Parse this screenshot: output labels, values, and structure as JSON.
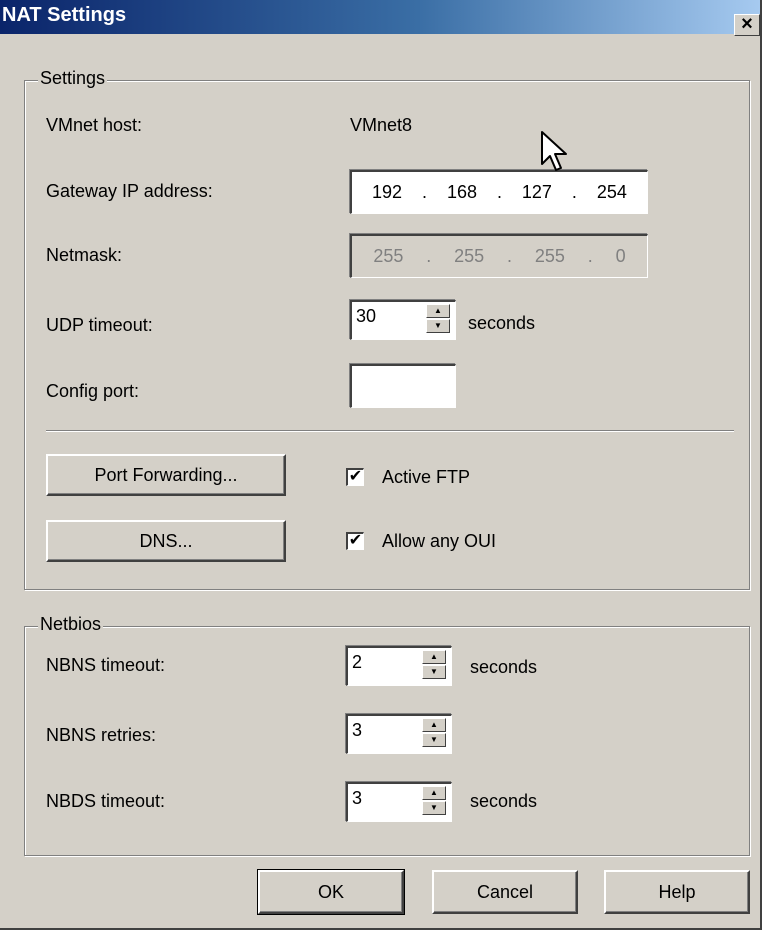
{
  "window": {
    "title": "NAT Settings",
    "close_glyph": "×"
  },
  "settings": {
    "legend": "Settings",
    "vmnet_host_label": "VMnet host:",
    "vmnet_host_value": "VMnet8",
    "gateway_label": "Gateway IP address:",
    "gateway_octets": [
      "192",
      "168",
      "127",
      "254"
    ],
    "netmask_label": "Netmask:",
    "netmask_octets": [
      "255",
      "255",
      "255",
      "0"
    ],
    "udp_timeout_label": "UDP timeout:",
    "udp_timeout_value": "30",
    "udp_timeout_unit": "seconds",
    "config_port_label": "Config port:",
    "config_port_value": "",
    "port_forwarding_button": "Port Forwarding...",
    "dns_button": "DNS...",
    "active_ftp_label": "Active FTP",
    "active_ftp_checked": true,
    "allow_oui_label": "Allow any OUI",
    "allow_oui_checked": true,
    "check_glyph": "✔"
  },
  "netbios": {
    "legend": "Netbios",
    "nbns_timeout_label": "NBNS timeout:",
    "nbns_timeout_value": "2",
    "nbns_timeout_unit": "seconds",
    "nbns_retries_label": "NBNS retries:",
    "nbns_retries_value": "3",
    "nbds_timeout_label": "NBDS timeout:",
    "nbds_timeout_value": "3",
    "nbds_timeout_unit": "seconds"
  },
  "footer": {
    "ok": "OK",
    "cancel": "Cancel",
    "help": "Help"
  },
  "icons": {
    "close": "close-icon",
    "spin_up": "spin-up-icon",
    "spin_down": "spin-down-icon",
    "cursor": "mouse-pointer-icon"
  },
  "colors": {
    "titlebar_start": "#0a246a",
    "titlebar_end": "#a6caf0",
    "dialog_bg": "#d4d0c8"
  }
}
